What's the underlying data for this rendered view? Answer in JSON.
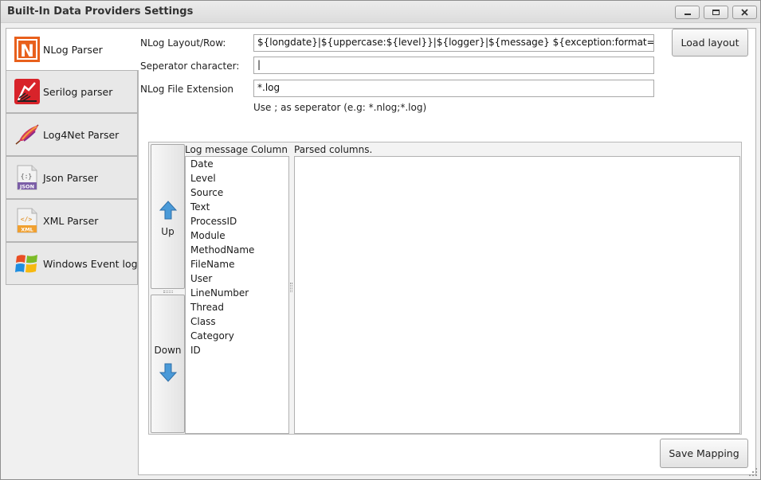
{
  "window": {
    "title": "Built-In Data Providers Settings"
  },
  "tabs": [
    {
      "label": "NLog Parser",
      "icon": "nlog-icon",
      "active": true
    },
    {
      "label": "Serilog parser",
      "icon": "serilog-icon",
      "active": false
    },
    {
      "label": "Log4Net Parser",
      "icon": "log4net-feather-icon",
      "active": false
    },
    {
      "label": "Json Parser",
      "icon": "json-file-icon",
      "active": false
    },
    {
      "label": "XML Parser",
      "icon": "xml-file-icon",
      "active": false
    },
    {
      "label": "Windows Event logs",
      "icon": "windows-logo-icon",
      "active": false
    }
  ],
  "form": {
    "layout_label": "NLog Layout/Row:",
    "layout_value": "${longdate}|${uppercase:${level}}|${logger}|${message} ${exception:format=tostring}",
    "separator_label": "Seperator character:",
    "separator_value": "|",
    "extension_label": "NLog File Extension",
    "extension_value": "*.log",
    "hint": "Use ; as seperator (e.g: *.nlog;*.log)",
    "load_layout_label": "Load layout"
  },
  "mapping": {
    "up_label": "Up",
    "down_label": "Down",
    "log_column_header": "Log message Column",
    "parsed_header": "Parsed columns.",
    "columns": [
      "Date",
      "Level",
      "Source",
      "Text",
      "ProcessID",
      "Module",
      "MethodName",
      "FileName",
      "User",
      "LineNumber",
      "Thread",
      "Class",
      "Category",
      "ID"
    ],
    "parsed_columns": []
  },
  "footer": {
    "save_label": "Save Mapping"
  },
  "icon_texts": {
    "nlog_letter": "N",
    "json_tag": "JSON",
    "xml_tag": "XML",
    "json_glyph": "{:}",
    "xml_glyph": "</>"
  },
  "colors": {
    "nlog_orange": "#e8601c",
    "serilog_red": "#d8232a",
    "json_purple": "#7b5ea7",
    "xml_orange": "#f0a030",
    "arrow_blue": "#4a9ad8"
  }
}
